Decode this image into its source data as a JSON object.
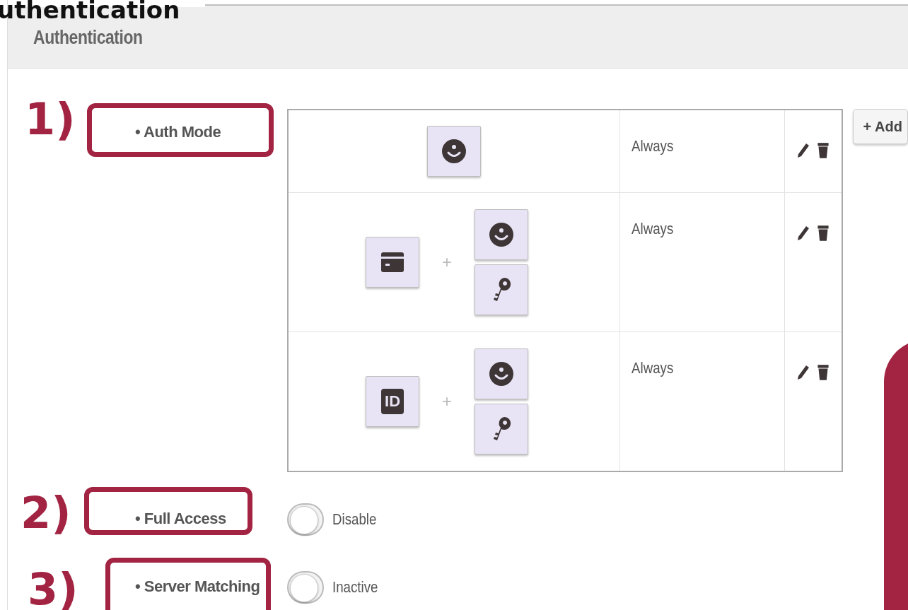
{
  "overlay_heading": "uthentication",
  "section_title": "Authentication",
  "auth_mode": {
    "number": "1)",
    "label": "• Auth Mode",
    "add_button": "+ Add",
    "rules": [
      {
        "groups": [
          [
            {
              "kind": "face"
            }
          ]
        ],
        "condition": "Always"
      },
      {
        "groups": [
          [
            {
              "kind": "card"
            }
          ],
          [
            {
              "kind": "face"
            },
            {
              "kind": "key"
            }
          ]
        ],
        "joiner": "+",
        "condition": "Always"
      },
      {
        "groups": [
          [
            {
              "kind": "id",
              "text": "ID"
            }
          ],
          [
            {
              "kind": "face"
            },
            {
              "kind": "key"
            }
          ]
        ],
        "joiner": "+",
        "condition": "Always"
      }
    ]
  },
  "settings": [
    {
      "number": "2)",
      "label": "• Full Access",
      "on": false,
      "status": "Disable"
    },
    {
      "number": "3)",
      "label": "• Server Matching",
      "on": false,
      "status": "Inactive"
    }
  ]
}
